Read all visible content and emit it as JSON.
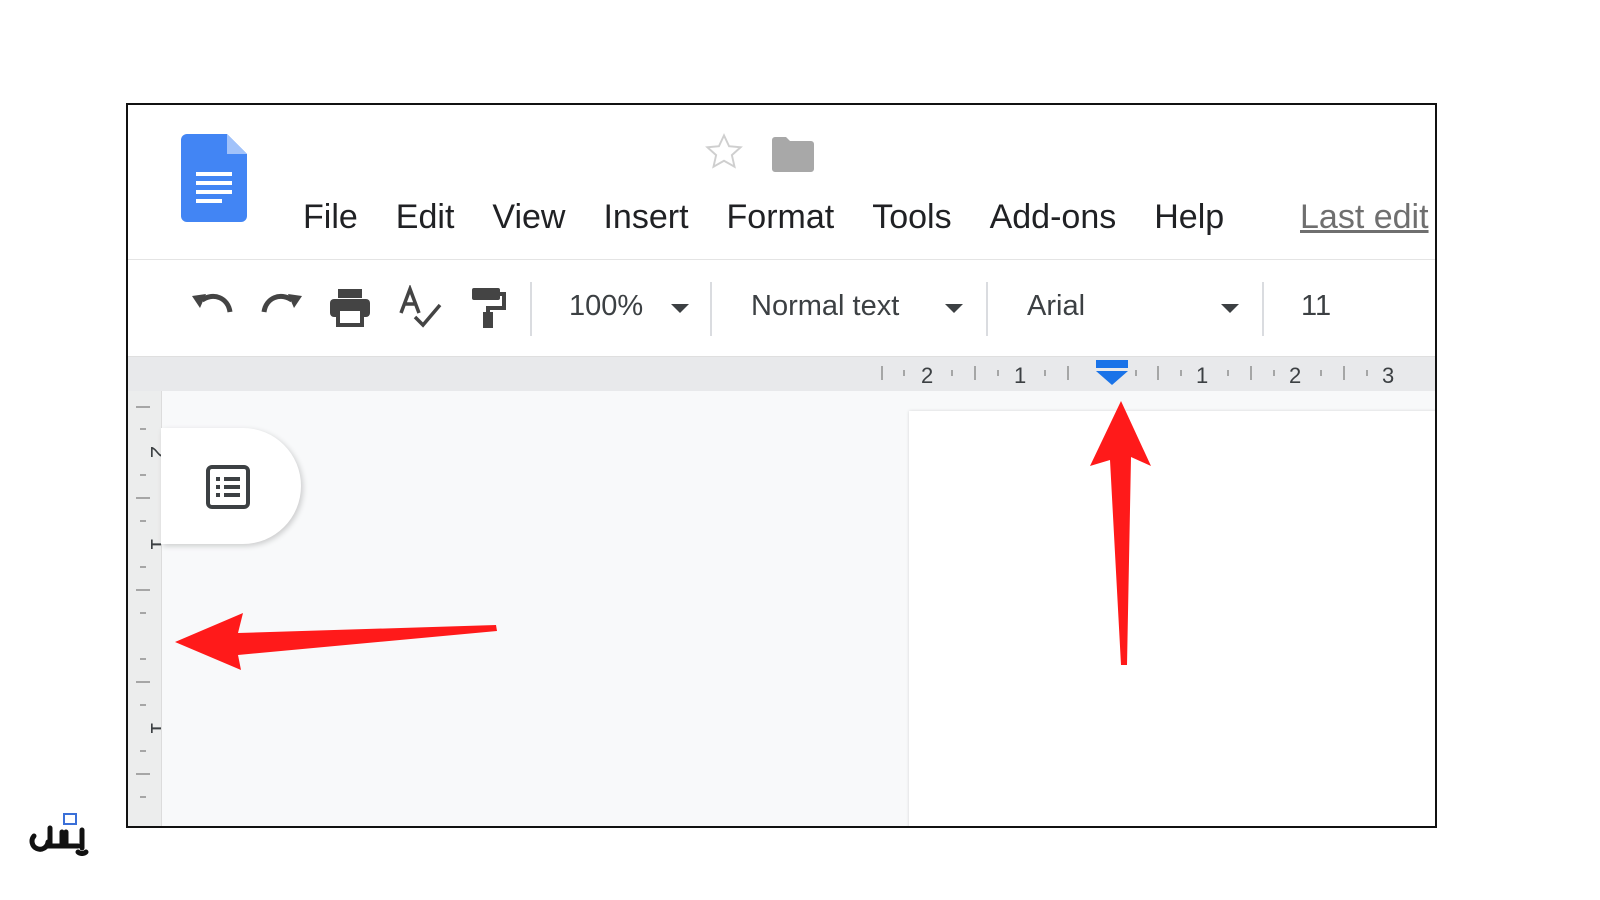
{
  "menu": {
    "items": [
      "File",
      "Edit",
      "View",
      "Insert",
      "Format",
      "Tools",
      "Add-ons",
      "Help"
    ],
    "last_edit": "Last edit"
  },
  "toolbar": {
    "zoom": "100%",
    "style": "Normal text",
    "font": "Arial",
    "font_size": "11"
  },
  "ruler": {
    "horizontal_labels": [
      "2",
      "1",
      "1",
      "2",
      "3"
    ],
    "vertical_labels": [
      "2",
      "1",
      "1"
    ]
  },
  "colors": {
    "docs_blue": "#4285f4",
    "indent_marker": "#1a73e8",
    "arrow_red": "#ff1a1a"
  },
  "icons": [
    "docs-logo-icon",
    "star-icon",
    "folder-icon",
    "undo-icon",
    "redo-icon",
    "print-icon",
    "spellcheck-icon",
    "paint-format-icon",
    "outline-icon",
    "indent-marker-icon"
  ]
}
